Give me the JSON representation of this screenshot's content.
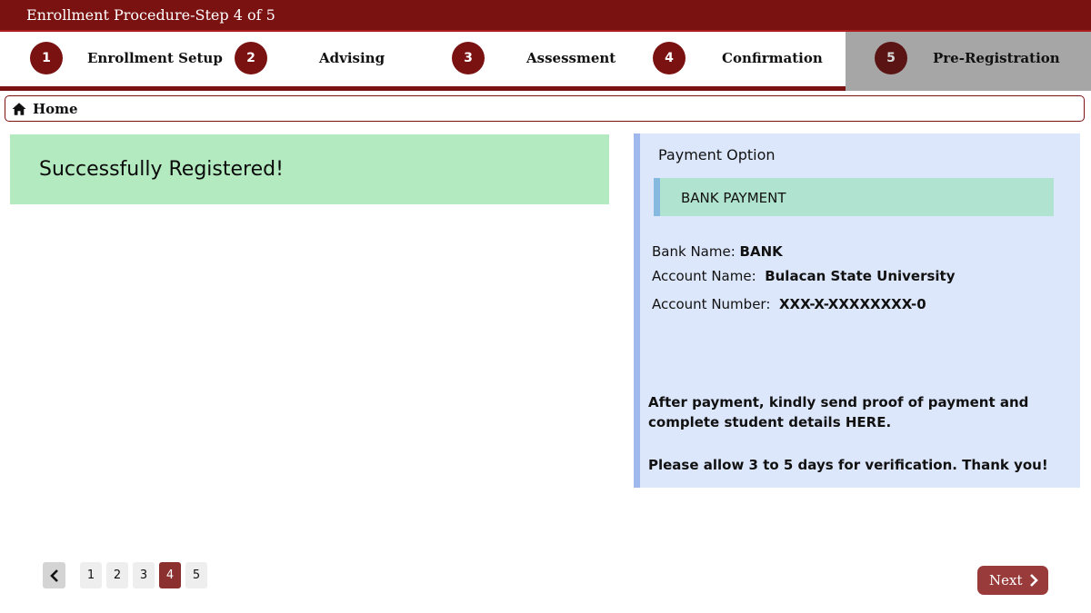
{
  "header": {
    "title": "Enrollment Procedure-Step 4 of 5"
  },
  "steps": [
    {
      "number": "1",
      "label": "Enrollment Setup"
    },
    {
      "number": "2",
      "label": "Advising"
    },
    {
      "number": "3",
      "label": "Assessment"
    },
    {
      "number": "4",
      "label": "Confirmation"
    },
    {
      "number": "5",
      "label": "Pre-Registration"
    }
  ],
  "breadcrumb": {
    "icon": "home-icon",
    "label": "Home"
  },
  "status": {
    "message": "Successfully Registered!"
  },
  "payment": {
    "title": "Payment Option",
    "method": "BANK PAYMENT",
    "bank_name_label": "Bank Name:",
    "bank_name": "BANK",
    "account_name_label": "Account Name:",
    "account_name": "Bulacan State University",
    "account_number_label": "Account Number:",
    "account_number": "XXX-X-XXXXXXXX-0",
    "note": "After payment, kindly send proof of payment and complete student  details HERE.",
    "verification": "Please allow 3 to 5 days for verification. Thank you!"
  },
  "pagination": {
    "pages": [
      "1",
      "2",
      "3",
      "4",
      "5"
    ],
    "current": "4",
    "prev_icon": "chevron-left-icon"
  },
  "next_button": {
    "label": "Next",
    "icon": "chevron-right-icon"
  },
  "colors": {
    "primary": "#7a1212",
    "success_bg": "#b3eac0",
    "panel_bg": "#dde7fc",
    "button": "#9a3b3b"
  }
}
